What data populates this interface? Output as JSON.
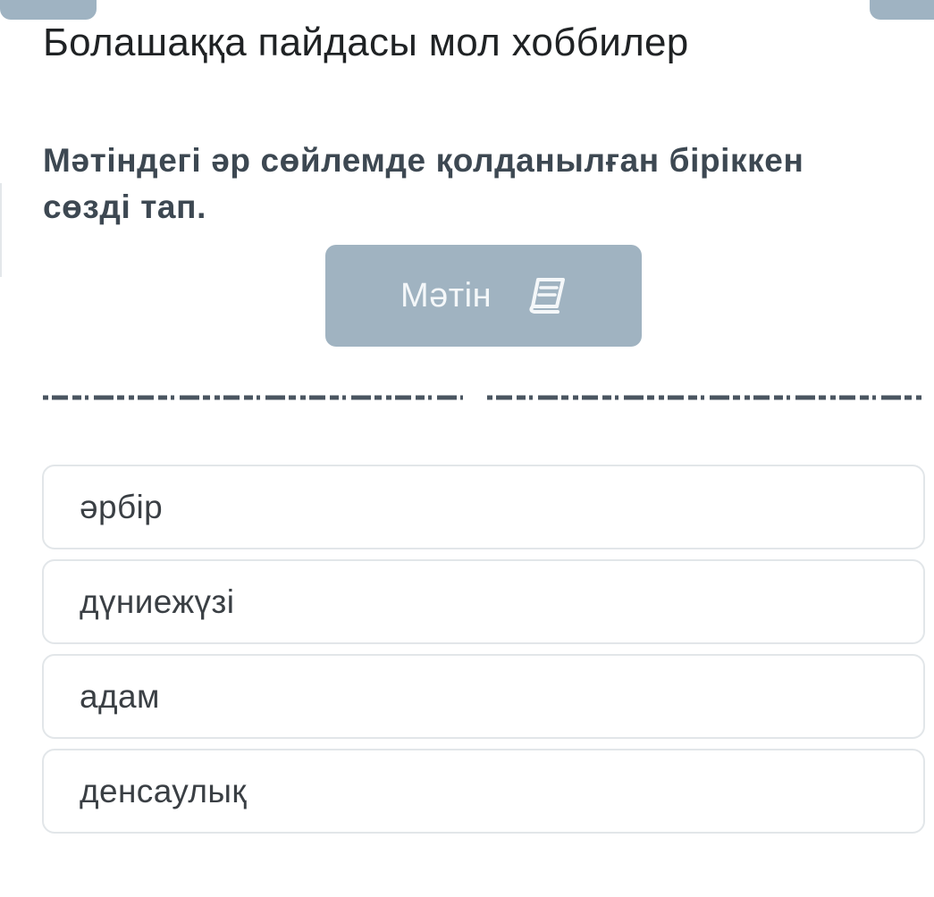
{
  "header": {
    "title": "Болашаққа пайдасы мол хоббилер"
  },
  "task": {
    "question": "Мәтіндегі әр сөйлемде қолданылған біріккен сөзді тап."
  },
  "text_button": {
    "label": "Мәтін",
    "icon": "book-icon"
  },
  "options": [
    {
      "label": "әрбір"
    },
    {
      "label": "дүниежүзі"
    },
    {
      "label": "адам"
    },
    {
      "label": "денсаулық"
    }
  ],
  "colors": {
    "button_bg": "#a0b3c1",
    "title_text": "#1f2224",
    "question_text": "#3d4852",
    "option_border": "#e2e6e9",
    "separator": "#4a5560"
  }
}
